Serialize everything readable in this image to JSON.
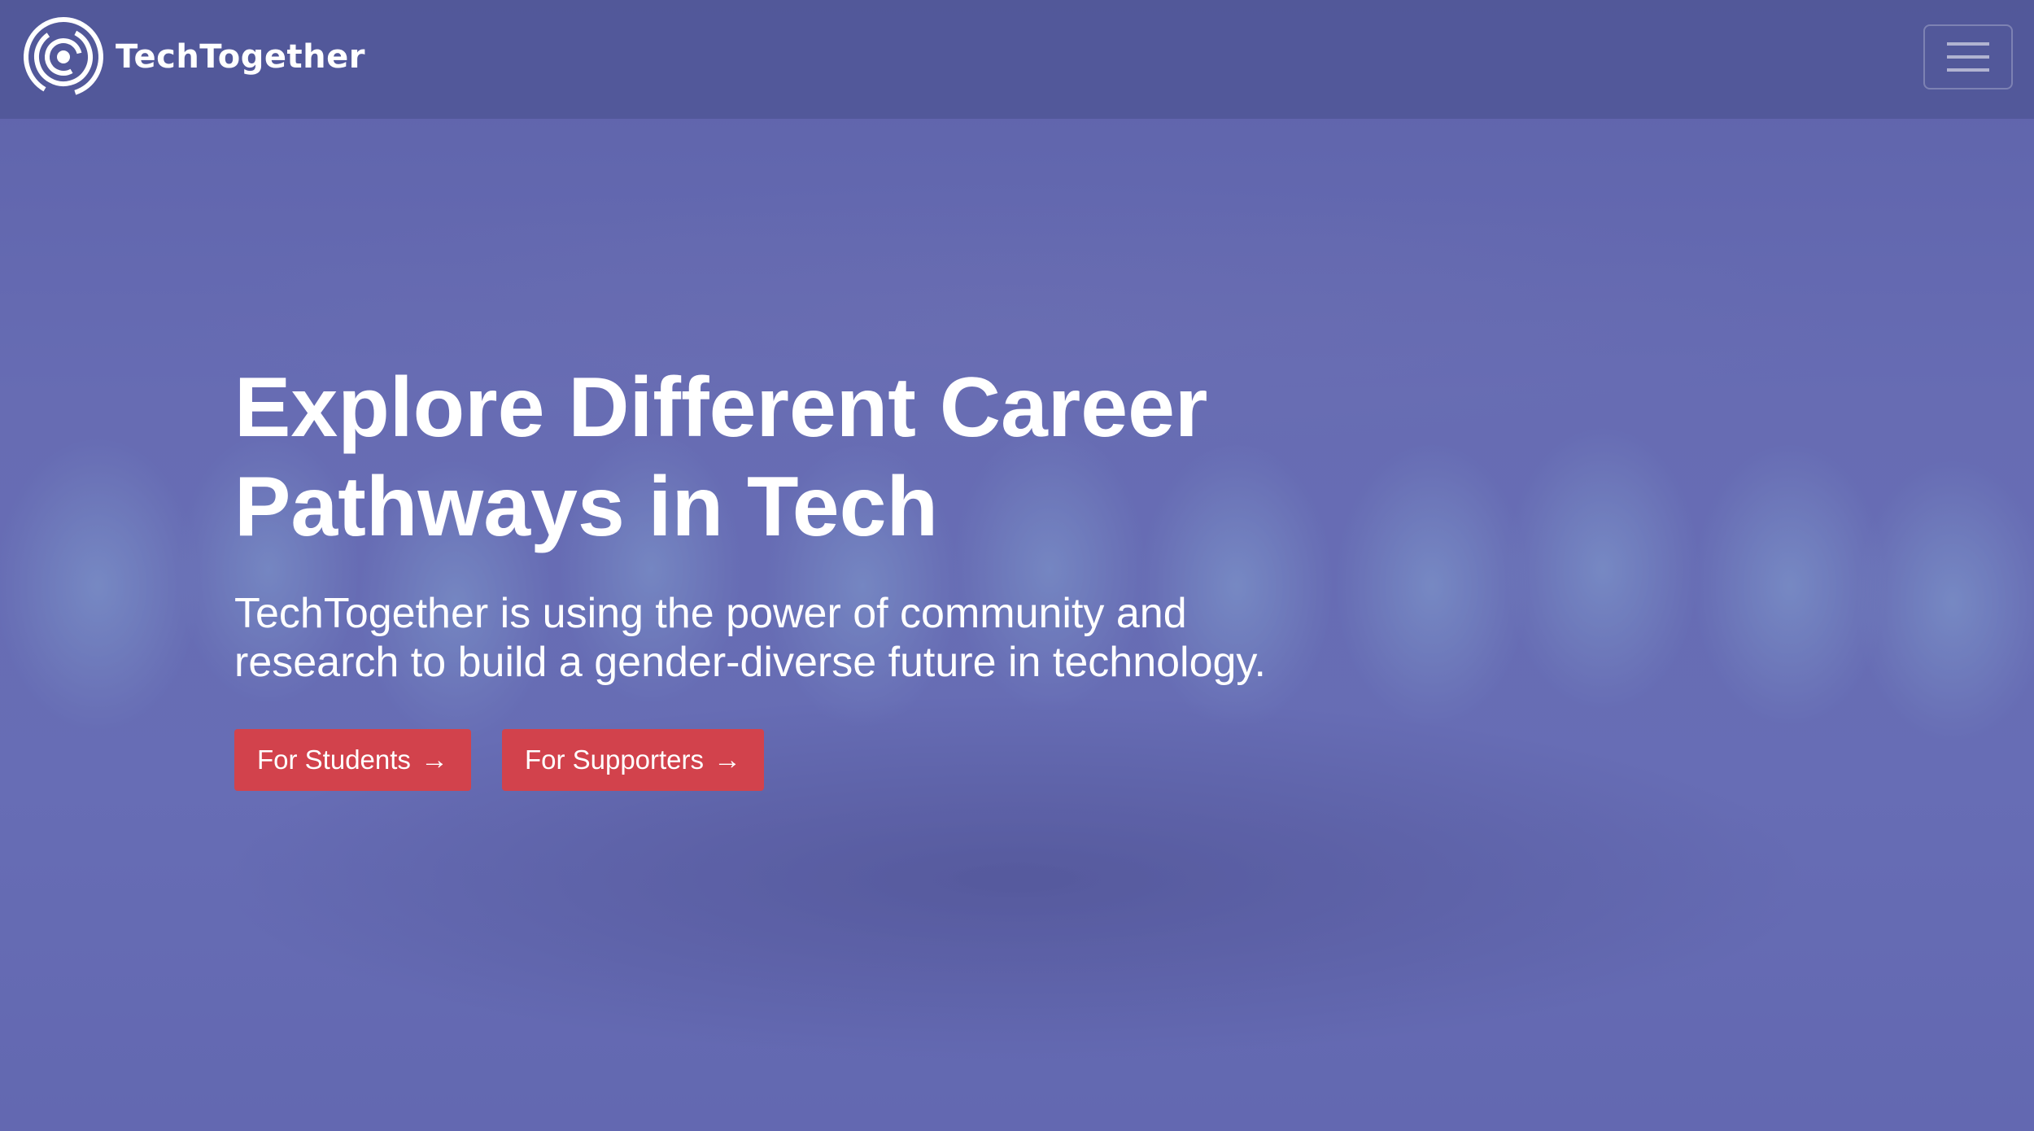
{
  "navbar": {
    "brand_name": "TechTogether",
    "logo_icon": "spiral-logo-icon",
    "menu_icon": "hamburger-menu-icon"
  },
  "hero": {
    "title": "Explore Different Career Pathways in Tech",
    "subtitle": "TechTogether is using the power of community and research to build a gender-diverse future in technology.",
    "buttons": [
      {
        "label": "For Students",
        "arrow": "→"
      },
      {
        "label": "For Supporters",
        "arrow": "→"
      }
    ]
  },
  "colors": {
    "overlay": "#6368b0",
    "navbar": "#50569a",
    "button": "#d2424c",
    "text": "#ffffff"
  }
}
